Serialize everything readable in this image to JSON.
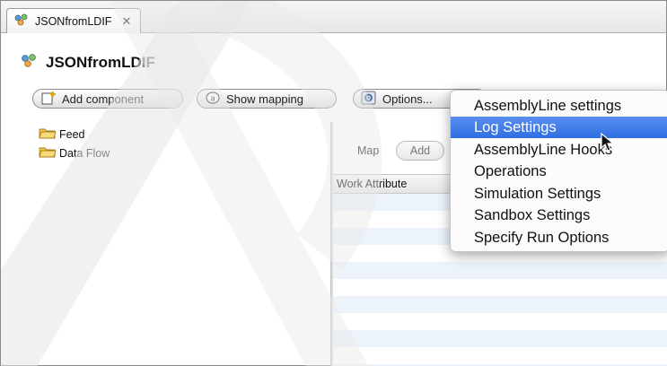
{
  "tab": {
    "label": "JSONfromLDIF",
    "close_glyph": "✕"
  },
  "editor": {
    "title": "JSONfromLDIF"
  },
  "toolbar": {
    "add_component": "Add component",
    "show_mapping": "Show mapping",
    "options": "Options..."
  },
  "tree": {
    "items": [
      {
        "label": "Feed"
      },
      {
        "label": "Data Flow"
      }
    ]
  },
  "right_pane": {
    "map_label": "Map",
    "add_button": "Add",
    "column_work_attribute": "Work Attribute"
  },
  "menu": {
    "items": [
      {
        "label": "AssemblyLine settings"
      },
      {
        "label": "Log Settings",
        "selected": true
      },
      {
        "label": "AssemblyLine Hooks"
      },
      {
        "label": "Operations"
      },
      {
        "label": "Simulation Settings"
      },
      {
        "label": "Sandbox Settings"
      },
      {
        "label": "Specify Run Options"
      }
    ]
  },
  "colors": {
    "menu_selection": "#2f6fe3",
    "table_stripe": "#edf3fb",
    "folder_yellow": "#f2c84b"
  },
  "icons": {
    "assembly_line": "assembly-line-icon",
    "add_component": "add-component-icon",
    "show_mapping": "show-mapping-icon",
    "options": "options-gear-icon",
    "folder": "folder-icon",
    "cursor": "mouse-pointer-icon"
  }
}
